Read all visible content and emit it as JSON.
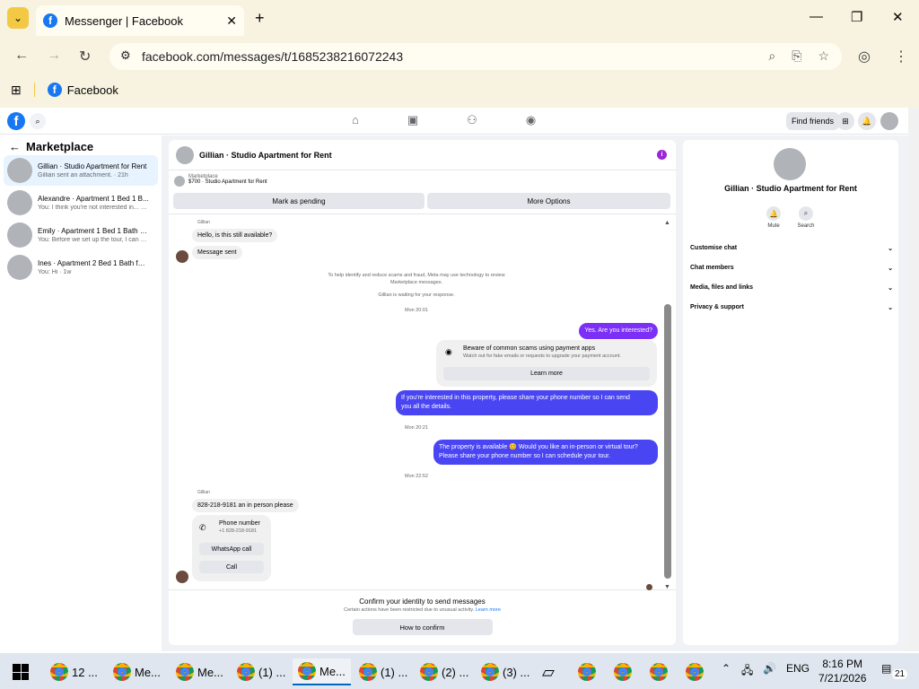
{
  "browser": {
    "tab_title": "Messenger | Facebook",
    "url": "facebook.com/messages/t/1685238216072243",
    "bookmark": "Facebook"
  },
  "fbnav": {
    "find_friends": "Find friends"
  },
  "sidebar": {
    "title": "Marketplace",
    "conversations": [
      {
        "name": "Gillian · Studio Apartment for Rent",
        "preview": "Gillian sent an attachment. · 21h"
      },
      {
        "name": "Alexandre · Apartment 1 Bed 1 B...",
        "preview": "You: I think you're not interested in... · 2d"
      },
      {
        "name": "Emily · Apartment 1 Bed 1 Bath for ...",
        "preview": "You: Before we set up the tour, I can s... · 3d"
      },
      {
        "name": "Ines · Apartment 2 Bed 1 Bath for ...",
        "preview": "You: Hi · 1w"
      }
    ]
  },
  "chat": {
    "title": "Gillian · Studio Apartment for Rent",
    "marketplace_label": "Marketplace",
    "listing": "$700 · Studio Apartment for Rent",
    "mark_pending": "Mark as pending",
    "more_options": "More Options",
    "sender": "Gillian",
    "msg1": "Hello, is this still available?",
    "msg2": "Message sent",
    "note1": "To help identify and reduce scams and fraud, Meta may use technology to review",
    "note2": "Marketplace messages.",
    "note3": "Gillian is waiting for your response.",
    "ts1": "Mon 20:01",
    "out1": "Yes. Are you interested?",
    "scam_title": "Beware of common scams using payment apps",
    "scam_sub": "Watch out for fake emails or requests to upgrade your payment account.",
    "learn_more": "Learn more",
    "out2a": "If you're interested in this property, please share your phone number so I can send",
    "out2b": "you all the details.",
    "ts2": "Mon 20:21",
    "out3a": "The property is available 😊 Would you like an in-person or virtual tour?",
    "out3b": "Please share your phone number so I can schedule your tour.",
    "ts3": "Mon 22:52",
    "sender2": "Gillian",
    "msg3": "828-218-9181 an in person please",
    "phone_label": "Phone number",
    "phone_value": "+1 828-218-9181",
    "whatsapp": "WhatsApp call",
    "call": "Call",
    "confirm_title": "Confirm your identity to send messages",
    "confirm_sub": "Certain actions have been restricted due to unusual activity.",
    "confirm_link": "Learn more",
    "how_to": "How to confirm"
  },
  "right": {
    "name": "Gillian · Studio Apartment for Rent",
    "mute": "Mute",
    "search": "Search",
    "items": [
      "Customise chat",
      "Chat members",
      "Media, files and links",
      "Privacy & support"
    ]
  },
  "taskbar": {
    "items": [
      "12 ...",
      "Me...",
      "Me...",
      "(1) ...",
      "Me...",
      "(1) ...",
      "(2) ...",
      "(3) ..."
    ],
    "lang": "ENG",
    "time": "8:16 PM",
    "date": "7/21/2026",
    "notif": "21"
  }
}
